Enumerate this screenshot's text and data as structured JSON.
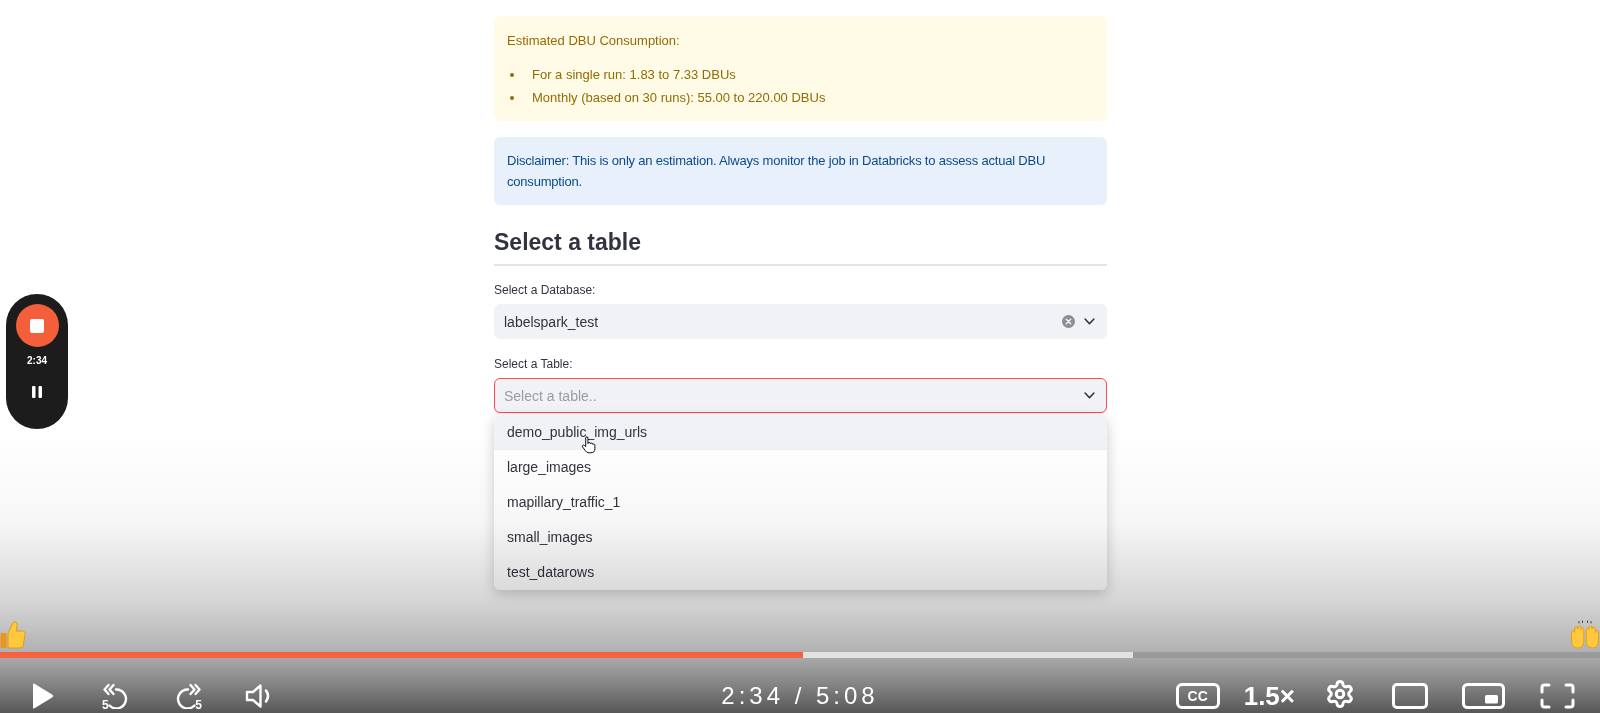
{
  "estimate_box": {
    "title": "Estimated DBU Consumption:",
    "items": [
      "For a single run: 1.83 to 7.33 DBUs",
      "Monthly (based on 30 runs): 55.00 to 220.00 DBUs"
    ]
  },
  "disclaimer_box": {
    "text": "Disclaimer: This is only an estimation. Always monitor the job in Databricks to assess actual DBU consumption."
  },
  "section": {
    "heading": "Select a table"
  },
  "fields": [
    {
      "label": "Select a Database:",
      "value": "labelspark_test",
      "clearable": true,
      "focused": false,
      "expanded": false
    },
    {
      "label": "Select a Table:",
      "placeholder": "Select a table..",
      "clearable": false,
      "focused": true,
      "expanded": true,
      "options": [
        {
          "label": "demo_public_img_urls",
          "selected": true
        },
        {
          "label": "large_images",
          "selected": false
        },
        {
          "label": "mapillary_traffic_1",
          "selected": false
        },
        {
          "label": "small_images",
          "selected": false
        },
        {
          "label": "test_datarows",
          "selected": false
        }
      ]
    }
  ],
  "recorder": {
    "time": "2:34"
  },
  "player": {
    "progress": {
      "level": 0.502
    },
    "buffer": {
      "level": 0.708
    },
    "seek_back": "5",
    "seek_forward": "5",
    "time": "2:34 / 5:08",
    "captions": "CC",
    "speed": "1.5×"
  }
}
